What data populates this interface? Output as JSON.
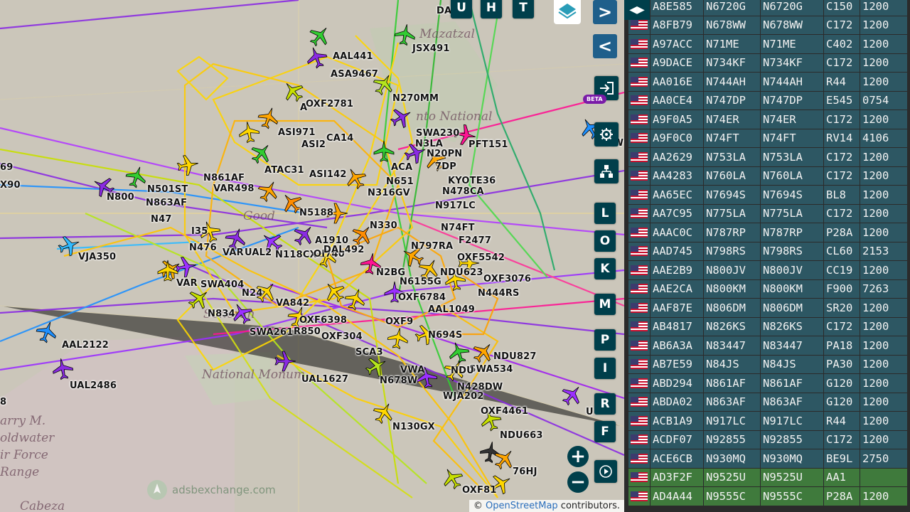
{
  "app": {
    "brand": "adsbexchange.com",
    "beta_badge": "BETA"
  },
  "map": {
    "placenames": [
      "Mazatzal",
      "nto National",
      "Good",
      "Sonoran",
      "National Monum",
      "arry M.\noldwater\nir Force\nRange",
      "Cabeza"
    ],
    "callsigns": [
      {
        "label": "DA"
      },
      {
        "label": "AAL441"
      },
      {
        "label": "JSX491"
      },
      {
        "label": "ASA9467"
      },
      {
        "label": "N270MM"
      },
      {
        "label": "OXF2781"
      },
      {
        "label": "A"
      },
      {
        "label": "ASI971"
      },
      {
        "label": "ASI2"
      },
      {
        "label": "CA14"
      },
      {
        "label": "SWA230"
      },
      {
        "label": "N20PN"
      },
      {
        "label": "PFT151"
      },
      {
        "label": "N3LA"
      },
      {
        "label": "7DP"
      },
      {
        "label": "N861AF"
      },
      {
        "label": "ATAC31"
      },
      {
        "label": "ASI142"
      },
      {
        "label": "ACA"
      },
      {
        "label": "KYOTE36"
      },
      {
        "label": "N651"
      },
      {
        "label": "N478CA"
      },
      {
        "label": "VAR498"
      },
      {
        "label": "N316GV"
      },
      {
        "label": "N501ST"
      },
      {
        "label": "N800"
      },
      {
        "label": "N863AF"
      },
      {
        "label": "N5188"
      },
      {
        "label": "N917LC"
      },
      {
        "label": "N47"
      },
      {
        "label": "N74FT"
      },
      {
        "label": "F2477"
      },
      {
        "label": "I35"
      },
      {
        "label": "N330"
      },
      {
        "label": "N476"
      },
      {
        "label": "VAR"
      },
      {
        "label": "UAL2"
      },
      {
        "label": "N118CX"
      },
      {
        "label": "OI740"
      },
      {
        "label": "A1910"
      },
      {
        "label": "N797RA"
      },
      {
        "label": "OXF5542"
      },
      {
        "label": "VJA350"
      },
      {
        "label": "DAL492"
      },
      {
        "label": "NDU623"
      },
      {
        "label": "N2BG"
      },
      {
        "label": "VAR"
      },
      {
        "label": "SWA404"
      },
      {
        "label": "N6155G"
      },
      {
        "label": "OXF3076"
      },
      {
        "label": "N24"
      },
      {
        "label": "N444RS"
      },
      {
        "label": "OXF6784"
      },
      {
        "label": "VA842"
      },
      {
        "label": "N834"
      },
      {
        "label": "AAL1049"
      },
      {
        "label": "OXF6398"
      },
      {
        "label": "OXF9"
      },
      {
        "label": "SWA261"
      },
      {
        "label": "R850"
      },
      {
        "label": "OXF304"
      },
      {
        "label": "N694S"
      },
      {
        "label": "AAL2122"
      },
      {
        "label": "NDU827"
      },
      {
        "label": "SCA3"
      },
      {
        "label": "SWA534"
      },
      {
        "label": "UAL1627"
      },
      {
        "label": "N678W"
      },
      {
        "label": "VWA"
      },
      {
        "label": "NDU"
      },
      {
        "label": "N428DW"
      },
      {
        "label": "UAL2486"
      },
      {
        "label": "WJA202"
      },
      {
        "label": "OXF4461"
      },
      {
        "label": "N130GX"
      },
      {
        "label": "NDU663"
      },
      {
        "label": "76HJ"
      },
      {
        "label": "OXF81"
      },
      {
        "label": "69"
      },
      {
        "label": "X90"
      },
      {
        "label": "8"
      },
      {
        "label": "U"
      },
      {
        "label": "SW"
      }
    ]
  },
  "controls": {
    "top_buttons": [
      "U",
      "H",
      "T"
    ],
    "side_letters": [
      "L",
      "O",
      "K",
      "M",
      "P",
      "I",
      "R",
      "F"
    ],
    "next_label": ">",
    "prev_label": "<",
    "zoom_in": "+",
    "zoom_out": "−",
    "toggle_label": "◀▶"
  },
  "attribution": {
    "prefix": "©",
    "link": "OpenStreetMap",
    "suffix": " contributors."
  },
  "table": {
    "rows": [
      {
        "hex": "A8E585",
        "reg": "N6720G",
        "cs": "N6720G",
        "type": "C150",
        "sq": "1200",
        "green": false
      },
      {
        "hex": "A8FB79",
        "reg": "N678WW",
        "cs": "N678WW",
        "type": "C172",
        "sq": "1200",
        "green": false
      },
      {
        "hex": "A97ACC",
        "reg": "N71ME",
        "cs": "N71ME",
        "type": "C402",
        "sq": "1200",
        "green": false
      },
      {
        "hex": "A9DACE",
        "reg": "N734KF",
        "cs": "N734KF",
        "type": "C172",
        "sq": "1200",
        "green": false
      },
      {
        "hex": "AA016E",
        "reg": "N744AH",
        "cs": "N744AH",
        "type": "R44",
        "sq": "1200",
        "green": false
      },
      {
        "hex": "AA0CE4",
        "reg": "N747DP",
        "cs": "N747DP",
        "type": "E545",
        "sq": "0754",
        "green": false
      },
      {
        "hex": "A9F0A5",
        "reg": "N74ER",
        "cs": "N74ER",
        "type": "C172",
        "sq": "1200",
        "green": false
      },
      {
        "hex": "A9F0C0",
        "reg": "N74FT",
        "cs": "N74FT",
        "type": "RV14",
        "sq": "4106",
        "green": false
      },
      {
        "hex": "AA2629",
        "reg": "N753LA",
        "cs": "N753LA",
        "type": "C172",
        "sq": "1200",
        "green": false
      },
      {
        "hex": "AA4283",
        "reg": "N760LA",
        "cs": "N760LA",
        "type": "C172",
        "sq": "1200",
        "green": false
      },
      {
        "hex": "AA65EC",
        "reg": "N7694S",
        "cs": "N7694S",
        "type": "BL8",
        "sq": "1200",
        "green": false
      },
      {
        "hex": "AA7C95",
        "reg": "N775LA",
        "cs": "N775LA",
        "type": "C172",
        "sq": "1200",
        "green": false
      },
      {
        "hex": "AAAC0C",
        "reg": "N787RP",
        "cs": "N787RP",
        "type": "P28A",
        "sq": "1200",
        "green": false
      },
      {
        "hex": "AAD745",
        "reg": "N798RS",
        "cs": "N798RS",
        "type": "CL60",
        "sq": "2153",
        "green": false
      },
      {
        "hex": "AAE2B9",
        "reg": "N800JV",
        "cs": "N800JV",
        "type": "CC19",
        "sq": "1200",
        "green": false
      },
      {
        "hex": "AAE2CA",
        "reg": "N800KM",
        "cs": "N800KM",
        "type": "F900",
        "sq": "7263",
        "green": false
      },
      {
        "hex": "AAF87E",
        "reg": "N806DM",
        "cs": "N806DM",
        "type": "SR20",
        "sq": "1200",
        "green": false
      },
      {
        "hex": "AB4817",
        "reg": "N826KS",
        "cs": "N826KS",
        "type": "C172",
        "sq": "1200",
        "green": false
      },
      {
        "hex": "AB6A3A",
        "reg": "N83447",
        "cs": "N83447",
        "type": "PA18",
        "sq": "1200",
        "green": false
      },
      {
        "hex": "AB7E59",
        "reg": "N84JS",
        "cs": "N84JS",
        "type": "PA30",
        "sq": "1200",
        "green": false
      },
      {
        "hex": "ABD294",
        "reg": "N861AF",
        "cs": "N861AF",
        "type": "G120",
        "sq": "1200",
        "green": false
      },
      {
        "hex": "ABDA02",
        "reg": "N863AF",
        "cs": "N863AF",
        "type": "G120",
        "sq": "1200",
        "green": false
      },
      {
        "hex": "ACB1A9",
        "reg": "N917LC",
        "cs": "N917LC",
        "type": "R44",
        "sq": "1200",
        "green": false
      },
      {
        "hex": "ACDF07",
        "reg": "N92855",
        "cs": "N92855",
        "type": "C172",
        "sq": "1200",
        "green": false
      },
      {
        "hex": "ACE6CB",
        "reg": "N930MQ",
        "cs": "N930MQ",
        "type": "BE9L",
        "sq": "2750",
        "green": false
      },
      {
        "hex": "AD3F2F",
        "reg": "N9525U",
        "cs": "N9525U",
        "type": "AA1",
        "sq": "",
        "green": true
      },
      {
        "hex": "AD4A44",
        "reg": "N9555C",
        "cs": "N9555C",
        "type": "P28A",
        "sq": "1200",
        "green": true
      }
    ]
  }
}
